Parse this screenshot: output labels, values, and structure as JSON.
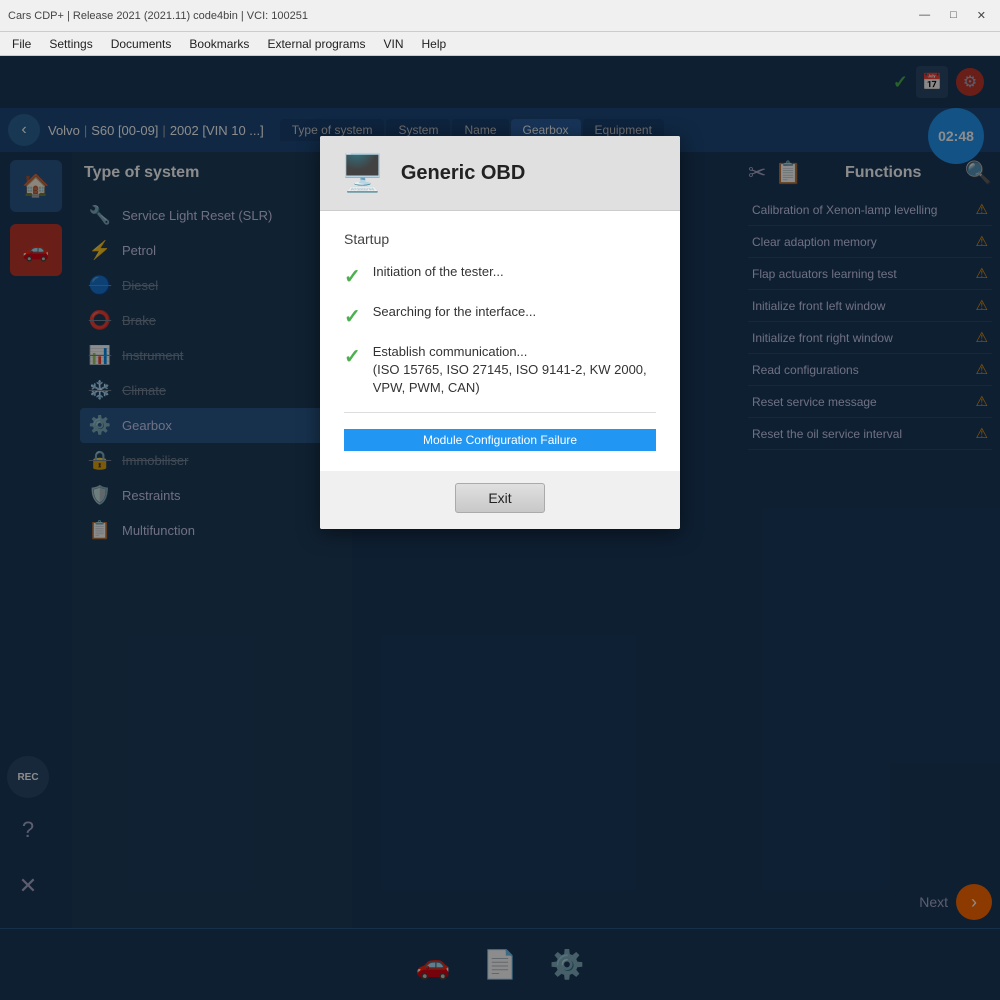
{
  "window": {
    "title": "Cars CDP+  | Release 2021 (2021.11) code4bin | VCI: 100251",
    "controls": [
      "—",
      "□",
      "✕"
    ]
  },
  "menu": {
    "items": [
      "File",
      "Settings",
      "Documents",
      "Bookmarks",
      "External programs",
      "VIN",
      "Help"
    ]
  },
  "toolbar": {
    "check": "✓",
    "clock": "02:48"
  },
  "nav": {
    "back_label": "‹",
    "breadcrumb": [
      "Volvo",
      "S60 [00-09]",
      "2002 [VIN 10 ...]"
    ],
    "tabs": [
      "Type of system",
      "System",
      "Name",
      "Gearbox",
      "Equipment"
    ]
  },
  "sidebar": {
    "home_icon": "🏠",
    "car_icon": "🚗"
  },
  "system_panel": {
    "title": "Type of system",
    "items": [
      {
        "icon": "🔧",
        "label": "Service Light Reset (SLR)",
        "disabled": false
      },
      {
        "icon": "⚡",
        "label": "Petrol",
        "disabled": false
      },
      {
        "icon": "🔵",
        "label": "Diesel",
        "disabled": true
      },
      {
        "icon": "⭕",
        "label": "Brake",
        "disabled": true
      },
      {
        "icon": "📊",
        "label": "Instrument",
        "disabled": true
      },
      {
        "icon": "❄️",
        "label": "Climate",
        "disabled": true
      },
      {
        "icon": "⚙️",
        "label": "Gearbox",
        "disabled": false,
        "active": true
      },
      {
        "icon": "🔒",
        "label": "Immobiliser",
        "disabled": true
      },
      {
        "icon": "🛡️",
        "label": "Restraints",
        "disabled": false
      },
      {
        "icon": "📋",
        "label": "Multifunction",
        "disabled": false
      }
    ]
  },
  "functions": {
    "title": "Functions",
    "items": [
      {
        "label": "Calibration of Xenon-lamp levelling",
        "warn": "⚠"
      },
      {
        "label": "Clear adaption memory",
        "warn": "⚠"
      },
      {
        "label": "Flap actuators learning test",
        "warn": "⚠"
      },
      {
        "label": "Initialize front left window",
        "warn": "⚠"
      },
      {
        "label": "Initialize front right window",
        "warn": "⚠"
      },
      {
        "label": "Read configurations",
        "warn": "⚠"
      },
      {
        "label": "Reset service message",
        "warn": "⚠"
      },
      {
        "label": "Reset the oil service interval",
        "warn": "⚠"
      }
    ],
    "next_label": "Next",
    "next_icon": "›"
  },
  "modal": {
    "title": "Generic OBD",
    "section_title": "Startup",
    "checks": [
      {
        "text": "Initiation of the tester..."
      },
      {
        "text": "Searching for the interface..."
      },
      {
        "text": "Establish communication...\n(ISO 15765, ISO 27145, ISO 9141-2, KW 2000, VPW, PWM, CAN)"
      }
    ],
    "exit_label": "Exit"
  },
  "status_bar": {
    "text": "Module Configuration Failure"
  },
  "bottom_icons": [
    "🚗",
    "📄",
    "⚙️"
  ],
  "left_icons": {
    "rec": "REC",
    "question": "?",
    "close": "✕"
  }
}
